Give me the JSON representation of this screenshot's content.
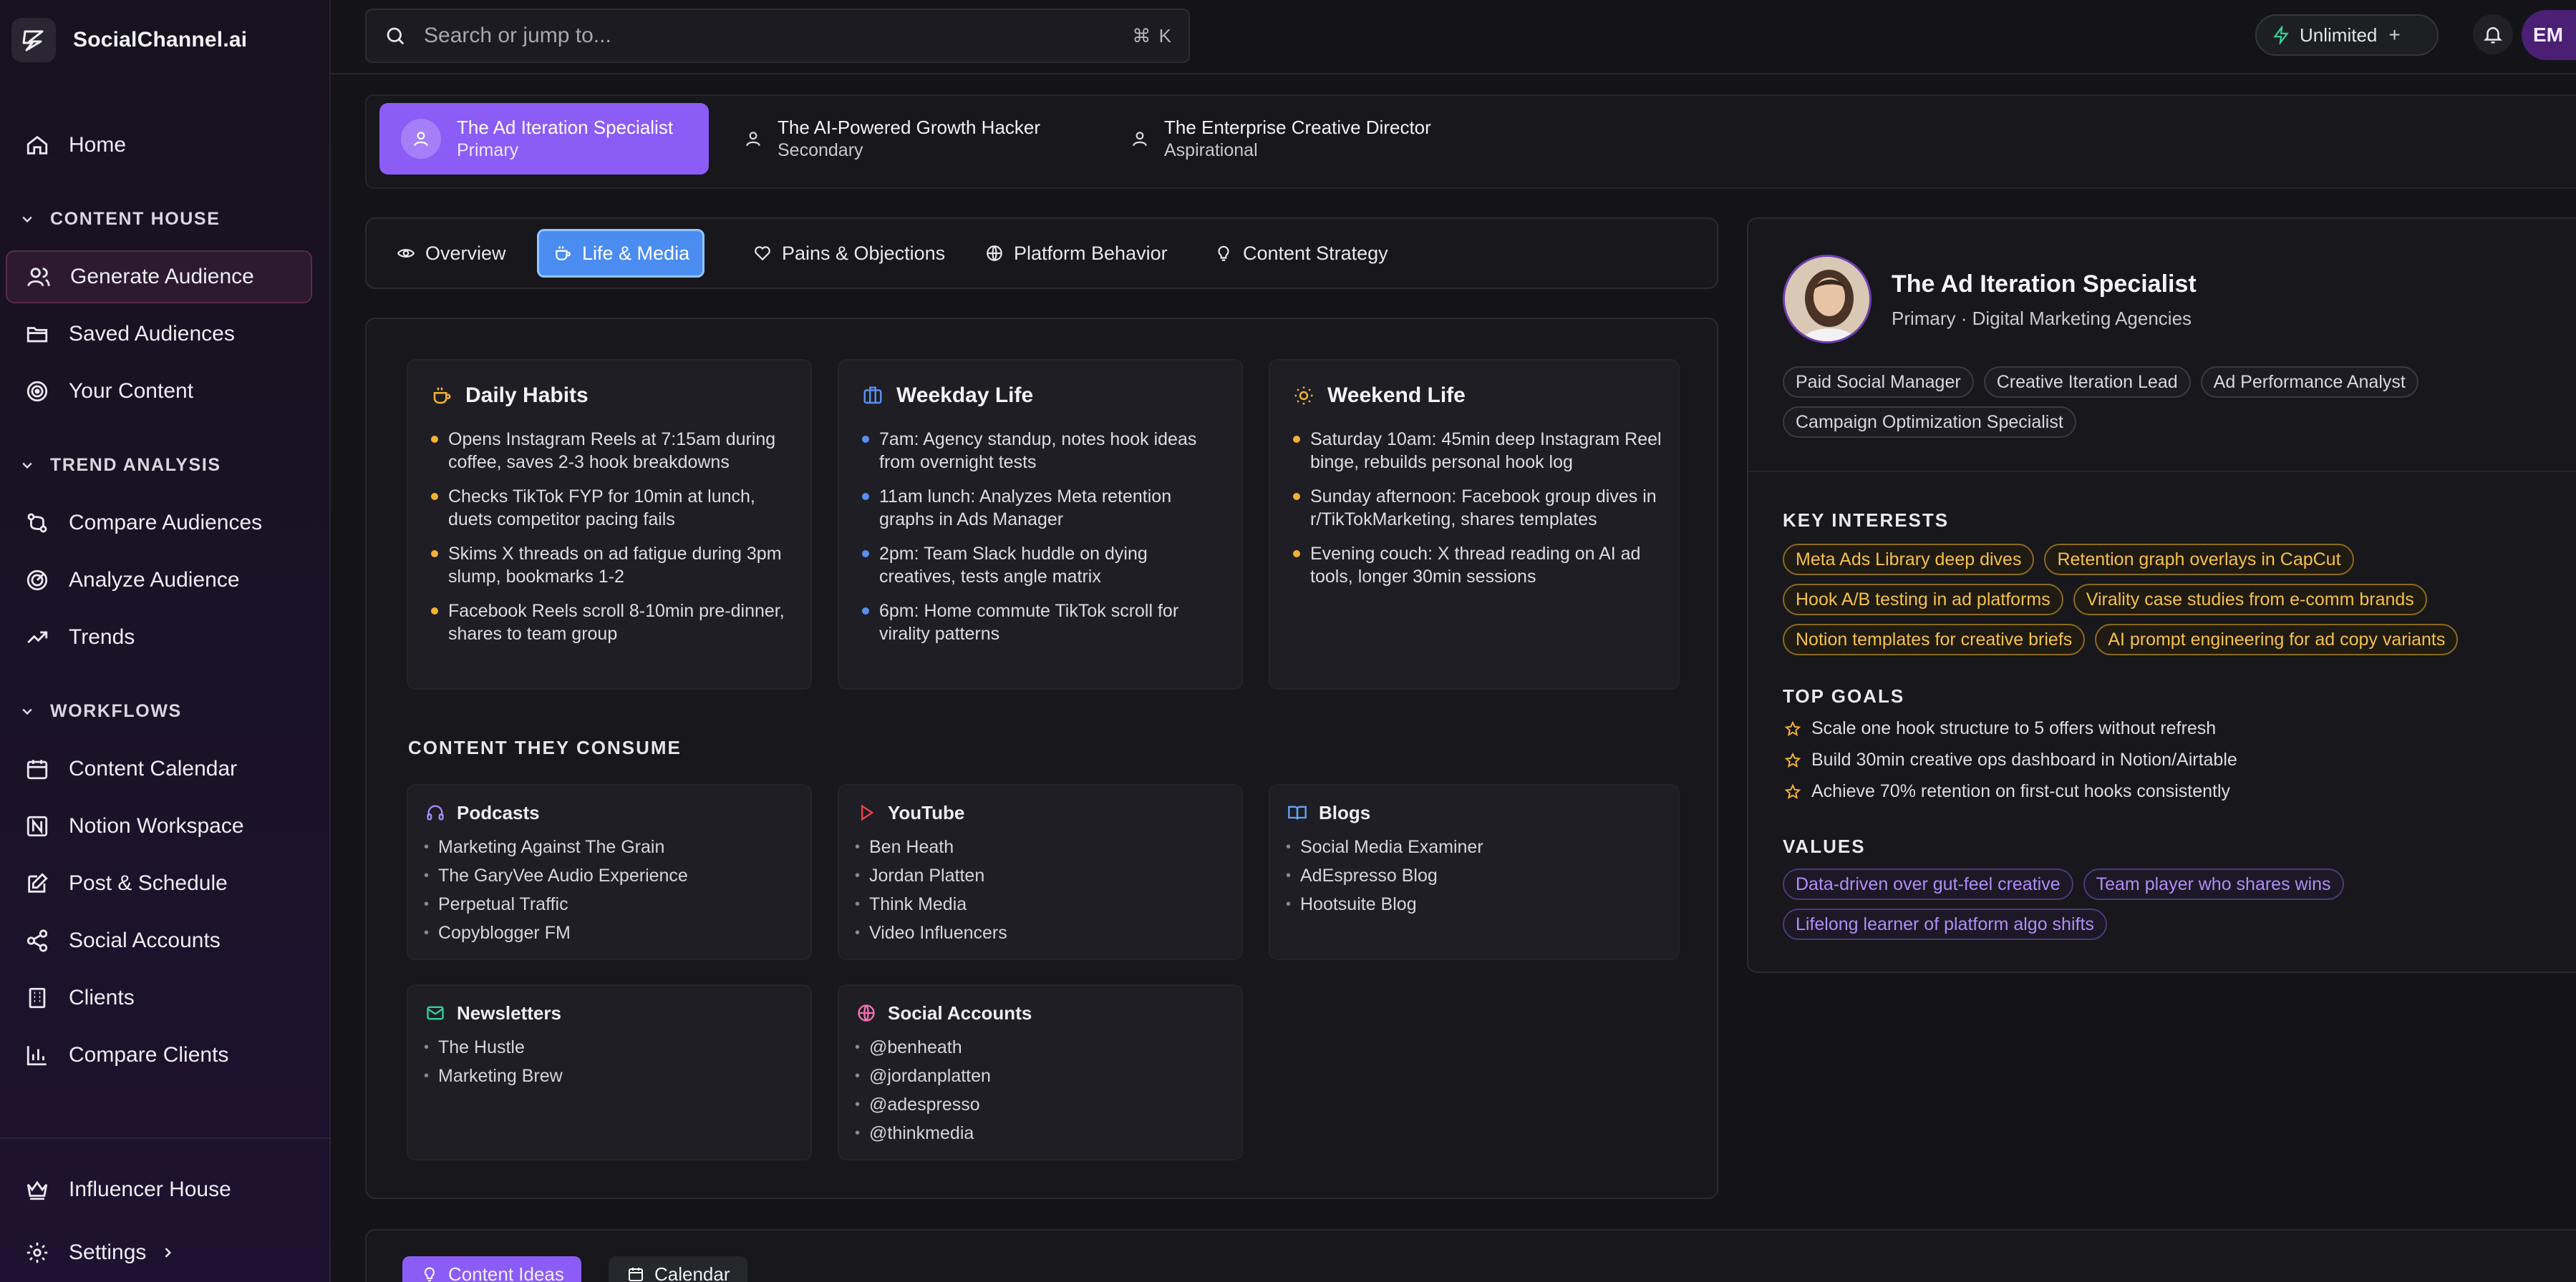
{
  "app": {
    "name": "SocialChannel.ai"
  },
  "sidebar": {
    "home": "Home",
    "sections": [
      {
        "title": "CONTENT HOUSE",
        "items": [
          "Generate Audience",
          "Saved Audiences",
          "Your Content"
        ]
      },
      {
        "title": "TREND ANALYSIS",
        "items": [
          "Compare Audiences",
          "Analyze Audience",
          "Trends"
        ]
      },
      {
        "title": "WORKFLOWS",
        "items": [
          "Content Calendar",
          "Notion Workspace",
          "Post & Schedule",
          "Social Accounts",
          "Clients",
          "Compare Clients"
        ]
      }
    ],
    "active_item": "Generate Audience",
    "influencer_house": "Influencer House",
    "settings": "Settings"
  },
  "topbar": {
    "search_placeholder": "Search or jump to...",
    "shortcut": "⌘ K",
    "plan": "Unlimited",
    "plan_action": "+",
    "user_initials": "EM"
  },
  "personas": [
    {
      "name": "The Ad Iteration Specialist",
      "tier": "Primary",
      "active": true
    },
    {
      "name": "The AI-Powered Growth Hacker",
      "tier": "Secondary",
      "active": false
    },
    {
      "name": "The Enterprise Creative Director",
      "tier": "Aspirational",
      "active": false
    }
  ],
  "tabs": [
    {
      "label": "Overview",
      "icon": "eye-icon"
    },
    {
      "label": "Life & Media",
      "icon": "coffee-icon",
      "active": true
    },
    {
      "label": "Pains & Objections",
      "icon": "heart-icon"
    },
    {
      "label": "Platform Behavior",
      "icon": "globe-icon"
    },
    {
      "label": "Content Strategy",
      "icon": "lightbulb-icon"
    }
  ],
  "life": {
    "daily": {
      "title": "Daily Habits",
      "items": [
        "Opens Instagram Reels at 7:15am during coffee, saves 2-3 hook breakdowns",
        "Checks TikTok FYP for 10min at lunch, duets competitor pacing fails",
        "Skims X threads on ad fatigue during 3pm slump, bookmarks 1-2",
        "Facebook Reels scroll 8-10min pre-dinner, shares to team group"
      ]
    },
    "weekday": {
      "title": "Weekday Life",
      "items": [
        "7am: Agency standup, notes hook ideas from overnight tests",
        "11am lunch: Analyzes Meta retention graphs in Ads Manager",
        "2pm: Team Slack huddle on dying creatives, tests angle matrix",
        "6pm: Home commute TikTok scroll for virality patterns"
      ]
    },
    "weekend": {
      "title": "Weekend Life",
      "items": [
        "Saturday 10am: 45min deep Instagram Reel binge, rebuilds personal hook log",
        "Sunday afternoon: Facebook group dives in r/TikTokMarketing, shares templates",
        "Evening couch: X thread reading on AI ad tools, longer 30min sessions"
      ]
    },
    "consume_label": "CONTENT THEY CONSUME",
    "media": {
      "podcasts": {
        "title": "Podcasts",
        "items": [
          "Marketing Against The Grain",
          "The GaryVee Audio Experience",
          "Perpetual Traffic",
          "Copyblogger FM"
        ]
      },
      "youtube": {
        "title": "YouTube",
        "items": [
          "Ben Heath",
          "Jordan Platten",
          "Think Media",
          "Video Influencers"
        ]
      },
      "blogs": {
        "title": "Blogs",
        "items": [
          "Social Media Examiner",
          "AdEspresso Blog",
          "Hootsuite Blog"
        ]
      },
      "newsletters": {
        "title": "Newsletters",
        "items": [
          "The Hustle",
          "Marketing Brew"
        ]
      },
      "social": {
        "title": "Social Accounts",
        "items": [
          "@benheath",
          "@jordanplatten",
          "@adespresso",
          "@thinkmedia"
        ]
      }
    }
  },
  "profile": {
    "name": "The Ad Iteration Specialist",
    "subtitle": "Primary · Digital Marketing Agencies",
    "roles": [
      "Paid Social Manager",
      "Creative Iteration Lead",
      "Ad Performance Analyst",
      "Campaign Optimization Specialist"
    ],
    "interests_label": "KEY INTERESTS",
    "interests": [
      "Meta Ads Library deep dives",
      "Retention graph overlays in CapCut",
      "Hook A/B testing in ad platforms",
      "Virality case studies from e-comm brands",
      "Notion templates for creative briefs",
      "AI prompt engineering for ad copy variants"
    ],
    "goals_label": "TOP GOALS",
    "goals": [
      "Scale one hook structure to 5 offers without refresh",
      "Build 30min creative ops dashboard in Notion/Airtable",
      "Achieve 70% retention on first-cut hooks consistently"
    ],
    "values_label": "VALUES",
    "values": [
      "Data-driven over gut-feel creative",
      "Team player who shares wins",
      "Lifelong learner of platform algo shifts"
    ]
  },
  "bottom": {
    "content_ideas": "Content Ideas",
    "calendar": "Calendar"
  },
  "colors": {
    "accent": "#8b5cf6",
    "tab_active": "#4a8cf0",
    "gold": "#f5c04a",
    "purple": "#b18cf7",
    "dot_gold": "#f2b134",
    "dot_blue": "#5b8def"
  }
}
